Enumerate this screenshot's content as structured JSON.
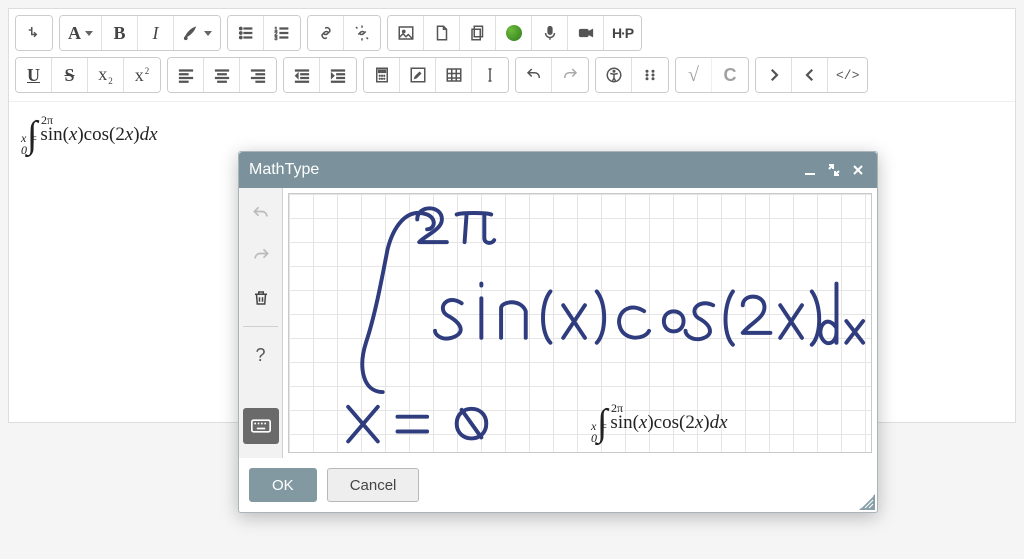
{
  "editor": {
    "math_upper": "2π",
    "math_lower": "x = 0",
    "math_body_html": "sin(x)cos(2x)dx"
  },
  "toolbar": {
    "row1": {
      "expand": "⤵",
      "font_family_label": "A",
      "bold": "B",
      "italic": "I",
      "ul": "•≡",
      "ol": "1≡",
      "link": "link",
      "unlink": "unlink",
      "image": "img",
      "file": "file",
      "copydoc": "copydoc",
      "mic": "mic",
      "video": "video",
      "h5p": "H5P"
    },
    "row2": {
      "underline": "U",
      "strike": "S",
      "subscript": "x",
      "superscript": "x",
      "table": "table",
      "undo": "undo",
      "redo": "redo",
      "sqrt": "√",
      "htmlcode": "</>"
    }
  },
  "mathtype": {
    "title": "MathType",
    "ok_label": "OK",
    "cancel_label": "Cancel",
    "handwriting_hint_upper": "2π",
    "handwriting_hint_lower": "x = 0",
    "recognized_upper": "2π",
    "recognized_lower": "x = 0",
    "recognized_body": "sin(x)cos(2x)dx",
    "help": "?"
  }
}
